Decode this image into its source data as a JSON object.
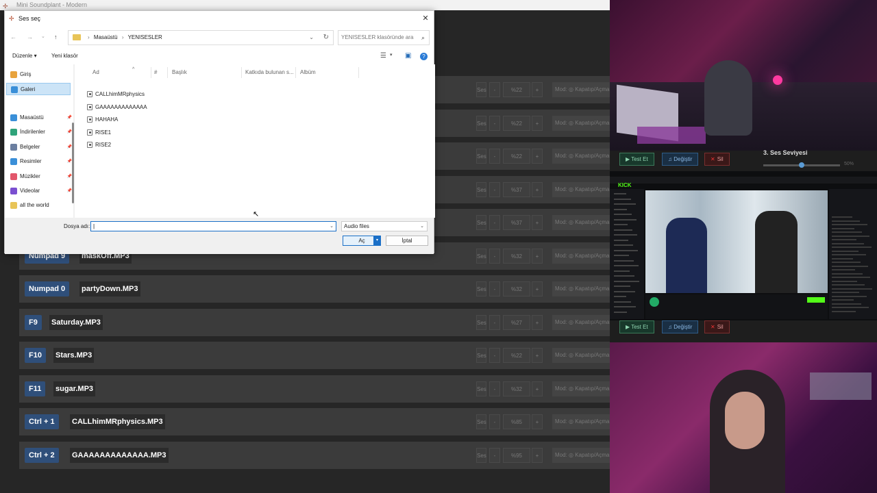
{
  "app": {
    "title": "Mini Soundplant - Modern"
  },
  "rows": [
    {
      "key": "",
      "file": "",
      "vol": "%22",
      "mod": "Mod: ◎ Kapatıp/Açma"
    },
    {
      "key": "",
      "file": "",
      "vol": "%22",
      "mod": "Mod: ◎ Kapatıp/Açma"
    },
    {
      "key": "",
      "file": "",
      "vol": "%22",
      "mod": "Mod: ◎ Kapatıp/Açma"
    },
    {
      "key": "",
      "file": "",
      "vol": "%37",
      "mod": "Mod: ◎ Kapatıp/Açma"
    },
    {
      "key": "",
      "file": "",
      "vol": "%37",
      "mod": "Mod: ◎ Kapatıp/Açma"
    },
    {
      "key": "Numpad 9",
      "file": "maskOff.MP3",
      "vol": "%32",
      "mod": "Mod: ◎ Kapatıp/Açma"
    },
    {
      "key": "Numpad 0",
      "file": "partyDown.MP3",
      "vol": "%32",
      "mod": "Mod: ◎ Kapatıp/Açma"
    },
    {
      "key": "F9",
      "file": "Saturday.MP3",
      "vol": "%27",
      "mod": "Mod: ◎ Kapatıp/Açma"
    },
    {
      "key": "F10",
      "file": "Stars.MP3",
      "vol": "%22",
      "mod": "Mod: ◎ Kapatıp/Açma"
    },
    {
      "key": "F11",
      "file": "sugar.MP3",
      "vol": "%32",
      "mod": "Mod: ◎ Kapatıp/Açma"
    },
    {
      "key": "Ctrl + 1",
      "file": "CALLhimMRphysics.MP3",
      "vol": "%85",
      "mod": "Mod: ◎ Kapatıp/Açma"
    },
    {
      "key": "Ctrl + 2",
      "file": "GAAAAAAAAAAAAA.MP3",
      "vol": "%95",
      "mod": "Mod: ◎ Kapatıp/Açma"
    }
  ],
  "row_controls": {
    "ses": "Ses",
    "minus": "-",
    "plus": "+"
  },
  "dialog": {
    "title": "Ses seç",
    "breadcrumb": [
      "Masaüstü",
      "YENISESLER"
    ],
    "search_placeholder": "YENISESLER klasöründe ara",
    "toolbar": {
      "organize": "Düzenle",
      "new_folder": "Yeni klasör"
    },
    "sidebar": [
      {
        "label": "Giriş",
        "icon": "home-icon",
        "color": "#e8a33d",
        "pinned": false
      },
      {
        "label": "Galeri",
        "icon": "gallery-icon",
        "color": "#3a8fd8",
        "pinned": false,
        "selected": true
      },
      {
        "label": "Masaüstü",
        "icon": "desktop-icon",
        "color": "#3a8fd8",
        "pinned": true
      },
      {
        "label": "İndirilenler",
        "icon": "download-icon",
        "color": "#2fa37a",
        "pinned": true
      },
      {
        "label": "Belgeler",
        "icon": "documents-icon",
        "color": "#6b7fa0",
        "pinned": true
      },
      {
        "label": "Resimler",
        "icon": "pictures-icon",
        "color": "#3a8fd8",
        "pinned": true
      },
      {
        "label": "Müzikler",
        "icon": "music-icon",
        "color": "#e2566b",
        "pinned": true
      },
      {
        "label": "Videolar",
        "icon": "videos-icon",
        "color": "#7a4fd0",
        "pinned": true
      },
      {
        "label": "all the world",
        "icon": "folder-icon",
        "color": "#e8c458",
        "pinned": false
      }
    ],
    "columns": [
      "Ad",
      "#",
      "Başlık",
      "Katkıda bulunan s...",
      "Albüm"
    ],
    "files": [
      "CALLhimMRphysics",
      "GAAAAAAAAAAAAA",
      "HAHAHA",
      "RISE1",
      "RISE2"
    ],
    "filename_label": "Dosya adı:",
    "filename_value": "",
    "filter": "Audio files",
    "open": "Aç",
    "cancel": "İptal"
  },
  "panel": {
    "test": "Test Et",
    "change": "Değiştir",
    "delete": "Sil",
    "volume_label": "3. Ses Seviyesi",
    "volume_pct": "50%",
    "volume_value": 0.5
  },
  "stream": {
    "logo": "KICK"
  }
}
